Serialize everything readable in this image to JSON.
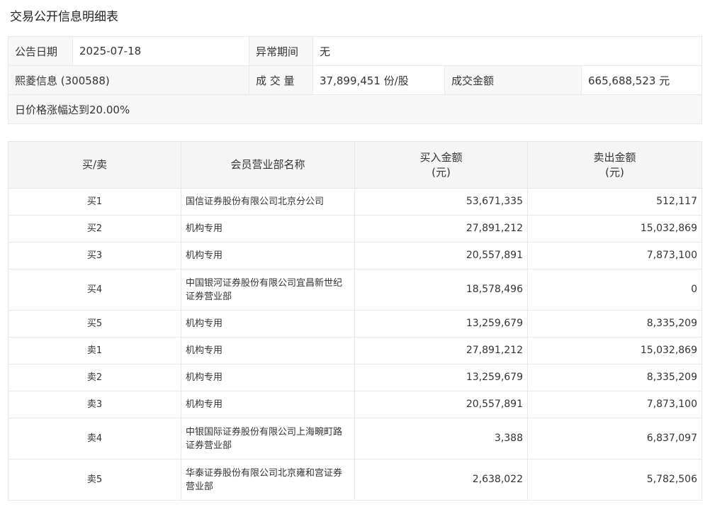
{
  "page": {
    "title": "交易公开信息明细表"
  },
  "info": {
    "date_label": "公告日期",
    "date_value": "2025-07-18",
    "abnormal_label": "异常期间",
    "abnormal_value": "无",
    "stock_name": "熙菱信息 (300588)",
    "volume_label": "成 交 量",
    "volume_value": "37,899,451 份/股",
    "amount_label": "成交金额",
    "amount_value": "665,688,523 元",
    "note": "日价格涨幅达到20.00%"
  },
  "detail": {
    "headers": {
      "side": "买/卖",
      "name": "会员营业部名称",
      "buy_line1": "买入金额",
      "buy_line2": "(元)",
      "sell_line1": "卖出金额",
      "sell_line2": "(元)"
    },
    "rows": [
      {
        "side": "买1",
        "name": "国信证券股份有限公司北京分公司",
        "buy": "53,671,335",
        "sell": "512,117"
      },
      {
        "side": "买2",
        "name": "机构专用",
        "buy": "27,891,212",
        "sell": "15,032,869"
      },
      {
        "side": "买3",
        "name": "机构专用",
        "buy": "20,557,891",
        "sell": "7,873,100"
      },
      {
        "side": "买4",
        "name": "中国银河证券股份有限公司宜昌新世纪证券营业部",
        "buy": "18,578,496",
        "sell": "0"
      },
      {
        "side": "买5",
        "name": "机构专用",
        "buy": "13,259,679",
        "sell": "8,335,209"
      },
      {
        "side": "卖1",
        "name": "机构专用",
        "buy": "27,891,212",
        "sell": "15,032,869"
      },
      {
        "side": "卖2",
        "name": "机构专用",
        "buy": "13,259,679",
        "sell": "8,335,209"
      },
      {
        "side": "卖3",
        "name": "机构专用",
        "buy": "20,557,891",
        "sell": "7,873,100"
      },
      {
        "side": "卖4",
        "name": "中银国际证券股份有限公司上海畹町路证券营业部",
        "buy": "3,388",
        "sell": "6,837,097"
      },
      {
        "side": "卖5",
        "name": "华泰证券股份有限公司北京雍和宫证券营业部",
        "buy": "2,638,022",
        "sell": "5,782,506"
      }
    ]
  }
}
